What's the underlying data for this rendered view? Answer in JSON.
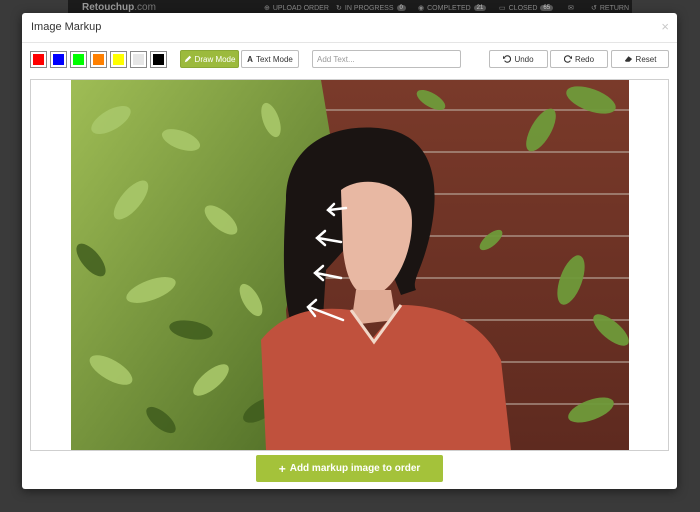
{
  "background": {
    "logo_re": "Re",
    "logo_touch": "touch",
    "logo_up": "up",
    "logo_dot": ".com",
    "nav": [
      {
        "label": "UPLOAD ORDER",
        "count": ""
      },
      {
        "label": "IN PROGRESS",
        "count": "0"
      },
      {
        "label": "COMPLETED",
        "count": "21"
      },
      {
        "label": "CLOSED",
        "count": "65"
      },
      {
        "label": "",
        "count": ""
      },
      {
        "label": "RETURN",
        "count": ""
      }
    ]
  },
  "modal": {
    "title": "Image Markup",
    "close_label": "×"
  },
  "toolbar": {
    "colors": [
      "#ff0000",
      "#0000ff",
      "#00ff00",
      "#ff8000",
      "#ffff00",
      "#e6e6e6",
      "#000000"
    ],
    "draw_mode_label": "Draw Mode",
    "text_mode_label": "Text Mode",
    "text_placeholder": "Add Text...",
    "undo_label": "Undo",
    "redo_label": "Redo",
    "reset_label": "Reset"
  },
  "footer": {
    "add_button_label": "Add markup image to order"
  }
}
